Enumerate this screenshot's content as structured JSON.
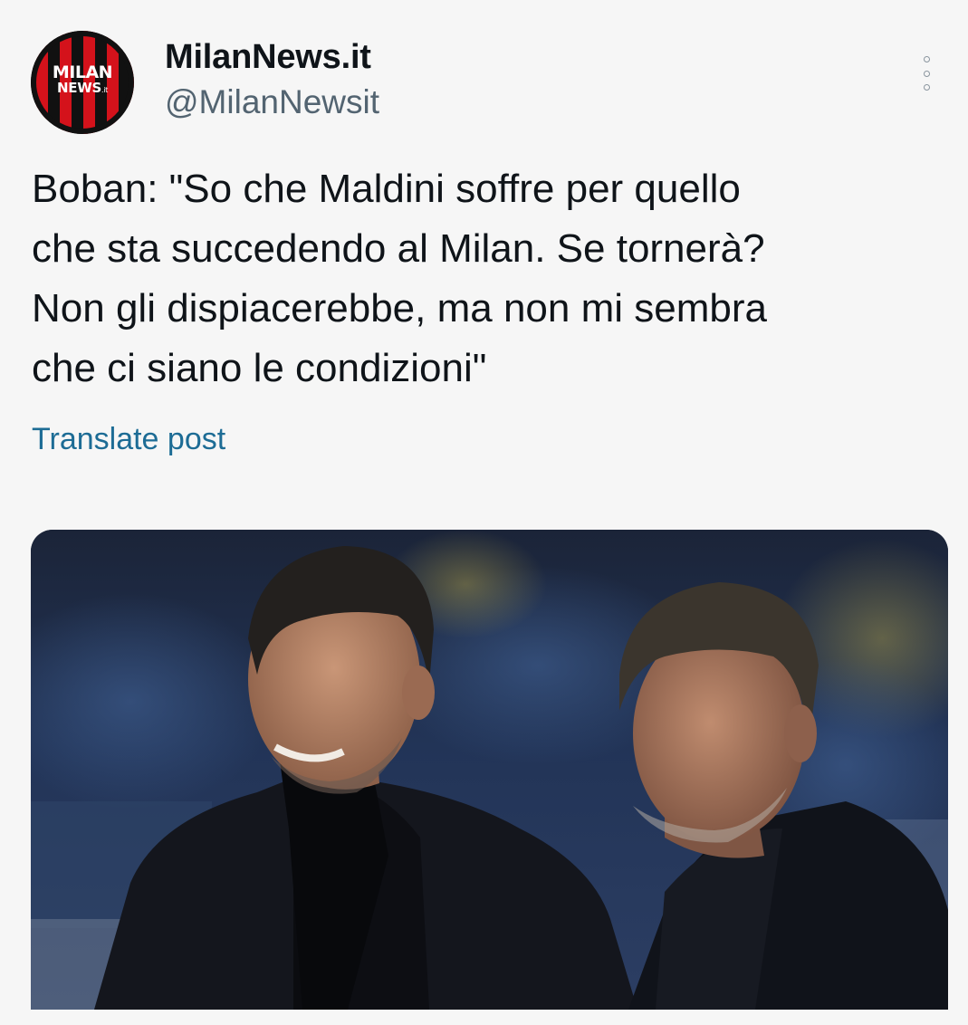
{
  "account": {
    "name": "MilanNews.it",
    "handle": "@MilanNewsit",
    "avatar": {
      "logo_line1": "MILAN",
      "logo_line2": "NEWS",
      "logo_suffix": ".it",
      "stripe_colors": [
        "#d4121b",
        "#111111"
      ]
    }
  },
  "post": {
    "text": "Boban: \"So che Maldini soffre per quello\nche sta succedendo al Milan. Se tornerà?\nNon gli dispiacerebbe, ma non mi sembra\nche ci siano le condizioni\"",
    "translate_label": "Translate post"
  },
  "media": {
    "type": "photo",
    "subject": "two men in dark coats in a stadium"
  },
  "icons": {
    "more": "more-options-icon"
  },
  "colors": {
    "text": "#0f1419",
    "secondary": "#536471",
    "link": "#1d6c95",
    "background": "#f6f6f6"
  }
}
